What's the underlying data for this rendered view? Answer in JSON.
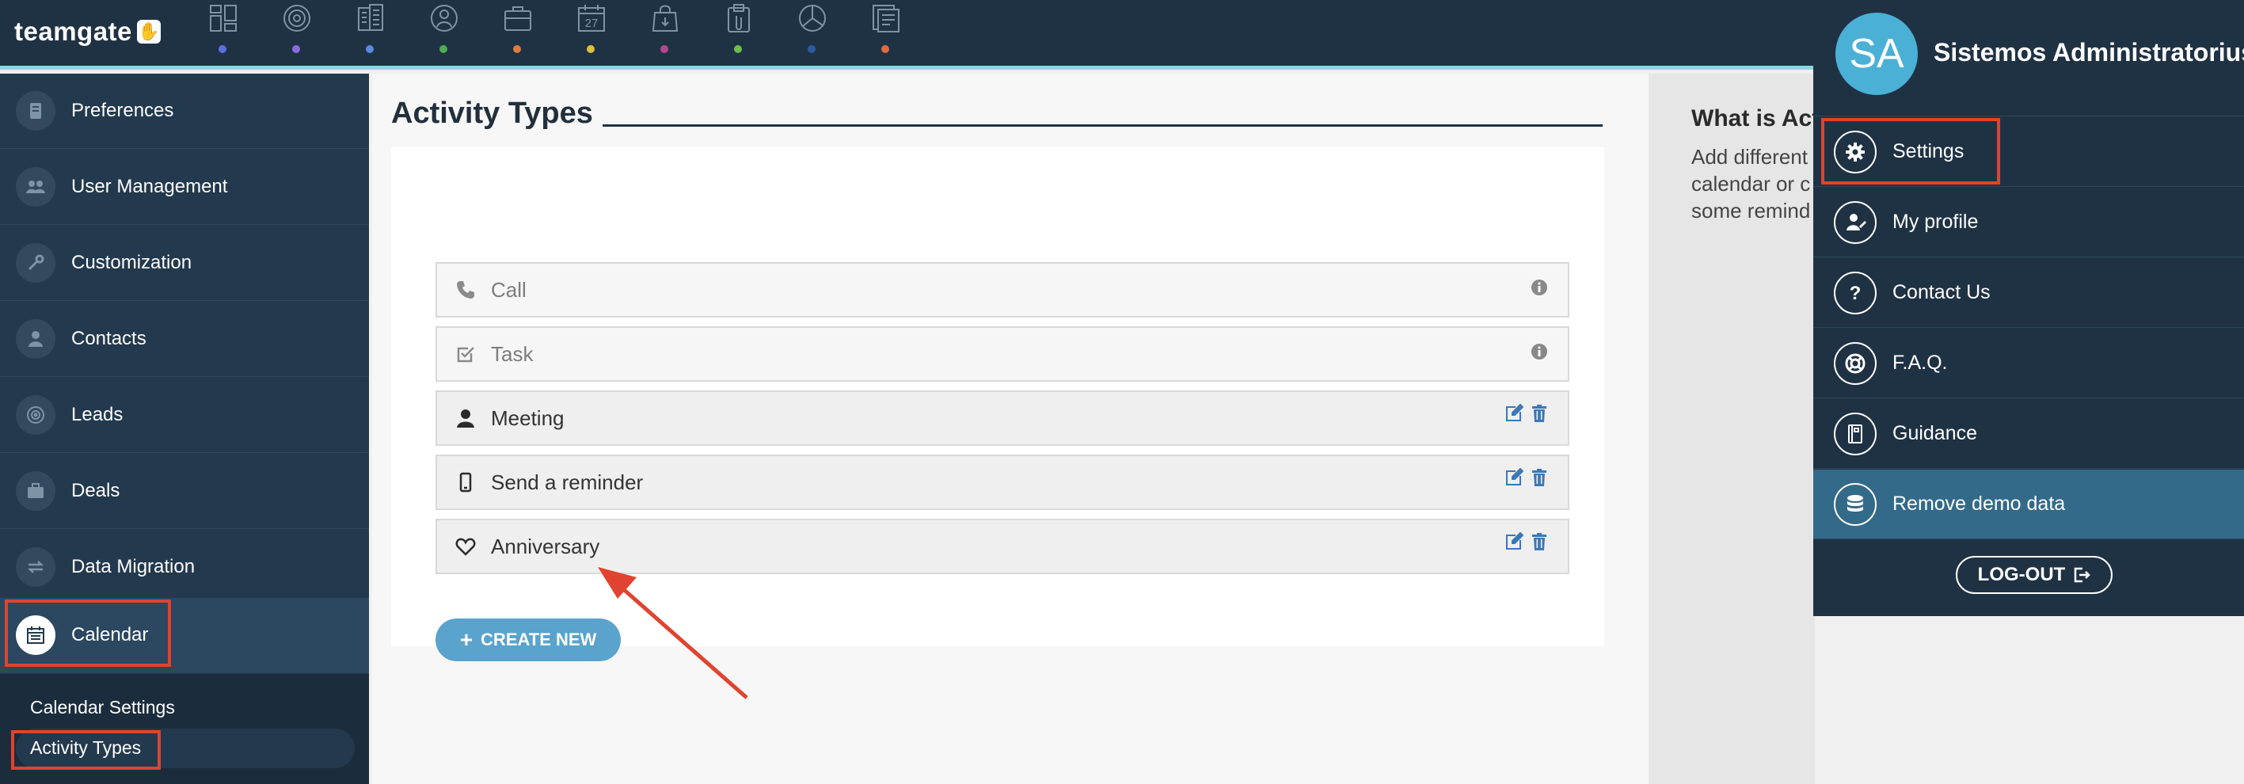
{
  "app": {
    "logo_text": "teamgate",
    "logo_mark": "✋"
  },
  "topbar": {
    "modules": [
      {
        "icon": "dashboard-icon",
        "dot_color": "#5b6ee1"
      },
      {
        "icon": "target-icon",
        "dot_color": "#8b6be0"
      },
      {
        "icon": "building-icon",
        "dot_color": "#5b8ce0"
      },
      {
        "icon": "contacts-icon",
        "dot_color": "#4caf50"
      },
      {
        "icon": "briefcase-icon",
        "dot_color": "#e07b39"
      },
      {
        "icon": "calendar-icon",
        "dot_color": "#e0c039",
        "label": "27"
      },
      {
        "icon": "shopping-bag-icon",
        "dot_color": "#b5478a"
      },
      {
        "icon": "clipboard-icon",
        "dot_color": "#6bbf4a"
      },
      {
        "icon": "pie-chart-icon",
        "dot_color": "#2c5aa0"
      },
      {
        "icon": "reports-icon",
        "dot_color": "#e06a39"
      }
    ]
  },
  "sidebar": {
    "items": [
      {
        "label": "Preferences",
        "icon": "preferences-icon"
      },
      {
        "label": "User Management",
        "icon": "users-icon"
      },
      {
        "label": "Customization",
        "icon": "wrench-icon"
      },
      {
        "label": "Contacts",
        "icon": "contact-icon"
      },
      {
        "label": "Leads",
        "icon": "leads-icon"
      },
      {
        "label": "Deals",
        "icon": "briefcase-icon"
      },
      {
        "label": "Data Migration",
        "icon": "migration-icon"
      },
      {
        "label": "Calendar",
        "icon": "calendar-icon",
        "active": true
      }
    ],
    "sub_items": [
      {
        "label": "Calendar Settings"
      },
      {
        "label": "Activity Types",
        "active": true
      }
    ]
  },
  "main": {
    "title": "Activity Types",
    "activity_types": [
      {
        "label": "Call",
        "icon": "phone-icon",
        "kind": "system"
      },
      {
        "label": "Task",
        "icon": "checkbox-icon",
        "kind": "system"
      },
      {
        "label": "Meeting",
        "icon": "person-icon",
        "kind": "custom"
      },
      {
        "label": "Send a reminder",
        "icon": "mobile-icon",
        "kind": "custom"
      },
      {
        "label": "Anniversary",
        "icon": "heart-icon",
        "kind": "custom"
      }
    ],
    "create_button_label": "CREATE NEW"
  },
  "info_panel": {
    "title": "What is Act",
    "lines": [
      "Add different",
      "calendar or c",
      "some remind"
    ]
  },
  "user_menu": {
    "initials": "SA",
    "name": "Sistemos Administratorius",
    "items": [
      {
        "label": "Settings",
        "icon": "gear-icon"
      },
      {
        "label": "My profile",
        "icon": "profile-icon"
      },
      {
        "label": "Contact Us",
        "icon": "question-icon"
      },
      {
        "label": "F.A.Q.",
        "icon": "lifebuoy-icon"
      },
      {
        "label": "Guidance",
        "icon": "book-icon"
      },
      {
        "label": "Remove demo data",
        "icon": "database-icon",
        "highlight": true
      }
    ],
    "logout_label": "LOG-OUT"
  },
  "colors": {
    "navy": "#1f3244",
    "sidebar": "#23394d",
    "accent_blue": "#5aa3cc",
    "avatar": "#4ab0d6",
    "highlight_item": "#336a8a",
    "annotation_red": "#e0432f",
    "action_blue": "#3a78b8"
  }
}
